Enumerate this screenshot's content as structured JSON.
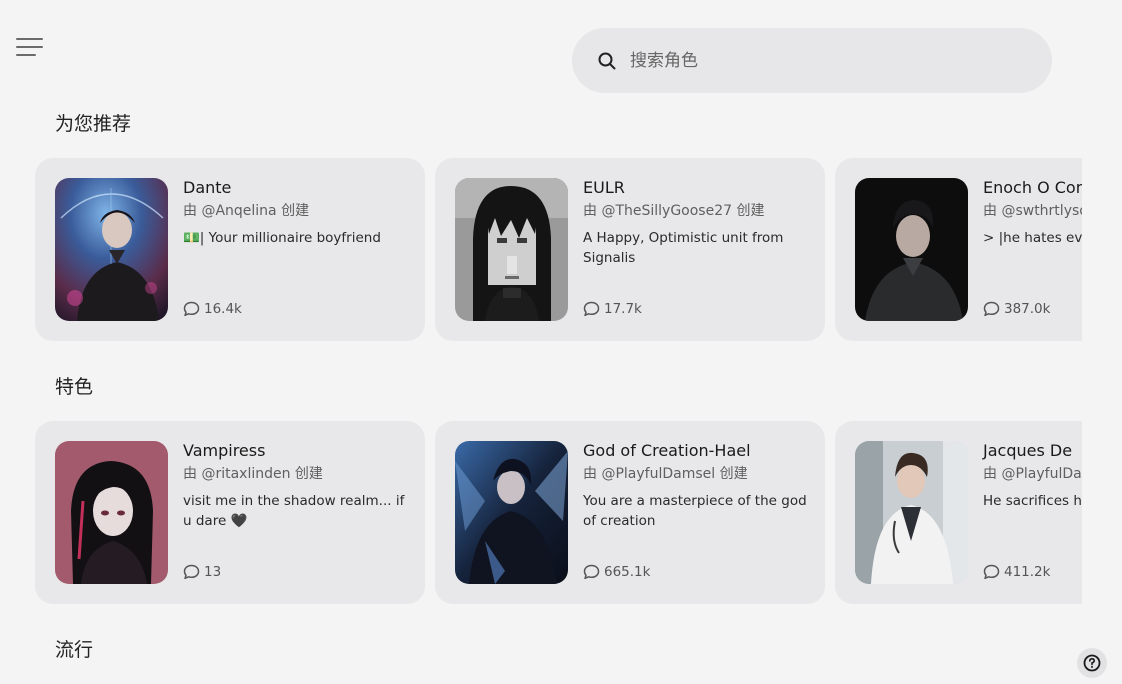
{
  "search": {
    "placeholder": "搜索角色"
  },
  "sections": [
    {
      "title": "为您推荐",
      "cards": [
        {
          "name": "Dante",
          "creator": "由 @Anqelina 创建",
          "description": "💵| Your millionaire boyfriend",
          "chats": "16.4k"
        },
        {
          "name": "EULR",
          "creator": "由 @TheSillyGoose27 创建",
          "description": "A Happy, Optimistic unit from Signalis",
          "chats": "17.7k"
        },
        {
          "name": "Enoch O Conne",
          "creator": "由 @swthrtlysol",
          "description": "> |he hates eve",
          "chats": "387.0k"
        }
      ]
    },
    {
      "title": "特色",
      "cards": [
        {
          "name": "Vampiress",
          "creator": "由 @ritaxlinden 创建",
          "description": "visit me in the shadow realm... if u dare 🖤",
          "chats": "13"
        },
        {
          "name": "God of Creation-Hael",
          "creator": "由 @PlayfulDamsel 创建",
          "description": "You are a masterpiece of the god of creation",
          "chats": "665.1k"
        },
        {
          "name": "Jacques De",
          "creator": "由 @PlayfulDa",
          "description": "He sacrifices h",
          "chats": "411.2k"
        }
      ]
    },
    {
      "title": "流行"
    }
  ],
  "colors": {
    "background": "#f4f4f4",
    "card": "#e8e8ea",
    "search": "#e7e7e9"
  },
  "icons": {
    "menu": "menu-icon",
    "search": "search-icon",
    "chat": "chat-bubble-icon",
    "help": "help-icon"
  }
}
